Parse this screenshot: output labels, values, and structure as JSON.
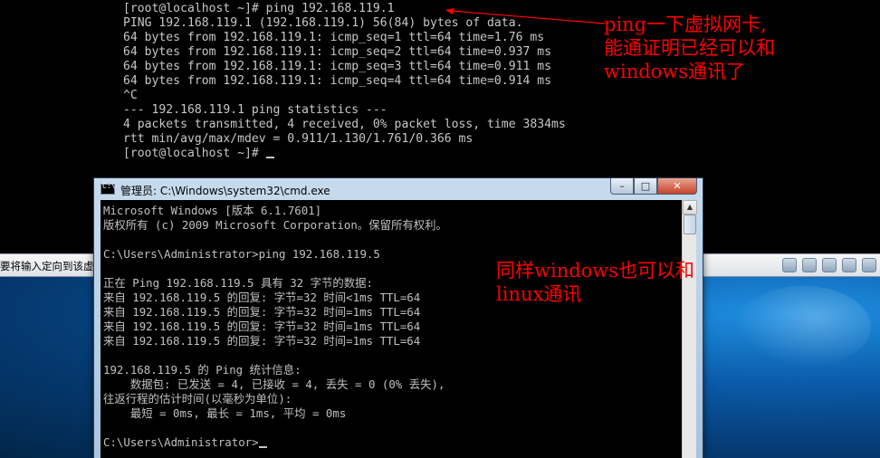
{
  "linux_terminal": {
    "lines": [
      "[root@localhost ~]# ping 192.168.119.1",
      "PING 192.168.119.1 (192.168.119.1) 56(84) bytes of data.",
      "64 bytes from 192.168.119.1: icmp_seq=1 ttl=64 time=1.76 ms",
      "64 bytes from 192.168.119.1: icmp_seq=2 ttl=64 time=0.937 ms",
      "64 bytes from 192.168.119.1: icmp_seq=3 ttl=64 time=0.911 ms",
      "64 bytes from 192.168.119.1: icmp_seq=4 ttl=64 time=0.914 ms",
      "^C",
      "--- 192.168.119.1 ping statistics ---",
      "4 packets transmitted, 4 received, 0% packet loss, time 3834ms",
      "rtt min/avg/max/mdev = 0.911/1.130/1.761/0.366 ms"
    ],
    "prompt": "[root@localhost ~]# "
  },
  "annotations": {
    "linux_note": [
      "ping一下虚拟网卡,",
      "能通证明已经可以和",
      "windows通讯了"
    ],
    "windows_note": [
      "同样windows也可以和",
      "linux通讯"
    ],
    "color": "#ff0000"
  },
  "host_window": {
    "status_text": "要将输入定向到该虚"
  },
  "cmd_window": {
    "title": "管理员: C:\\Windows\\system32\\cmd.exe",
    "buttons": {
      "minimize": "–",
      "maximize": "□",
      "close": "✕"
    },
    "lines": [
      "Microsoft Windows [版本 6.1.7601]",
      "版权所有 (c) 2009 Microsoft Corporation。保留所有权利。",
      "",
      "C:\\Users\\Administrator>ping 192.168.119.5",
      "",
      "正在 Ping 192.168.119.5 具有 32 字节的数据:",
      "来自 192.168.119.5 的回复: 字节=32 时间<1ms TTL=64",
      "来自 192.168.119.5 的回复: 字节=32 时间=1ms TTL=64",
      "来自 192.168.119.5 的回复: 字节=32 时间=1ms TTL=64",
      "来自 192.168.119.5 的回复: 字节=32 时间=1ms TTL=64",
      "",
      "192.168.119.5 的 Ping 统计信息:",
      "    数据包: 已发送 = 4, 已接收 = 4, 丢失 = 0 (0% 丢失),",
      "往返行程的估计时间(以毫秒为单位):",
      "    最短 = 0ms, 最长 = 1ms, 平均 = 0ms",
      ""
    ],
    "prompt": "C:\\Users\\Administrator>"
  }
}
